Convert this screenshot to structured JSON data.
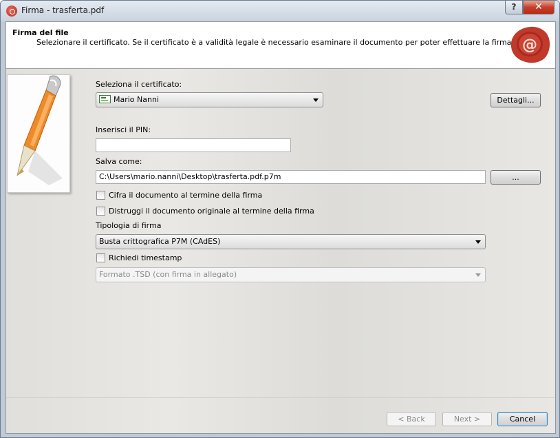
{
  "window": {
    "title": "Firma - trasferta.pdf",
    "help_label": "?",
    "close_label": "✕"
  },
  "header": {
    "title": "Firma del file",
    "subtitle": "Selezionare il certificato. Se il certificato è a validità legale è necessario esaminare il documento per poter effettuare la firma",
    "seal_text": "@"
  },
  "form": {
    "certificate_label": "Seleziona il certificato:",
    "certificate_value": "Mario Nanni",
    "details_button": "Dettagli...",
    "pin_label": "Inserisci il PIN:",
    "pin_value": "",
    "save_as_label": "Salva come:",
    "save_as_value": "C:\\Users\\mario.nanni\\Desktop\\trasferta.pdf.p7m",
    "browse_button": "...",
    "encrypt_label": "Cifra il documento al termine della firma",
    "encrypt_checked": false,
    "destroy_label": "Distruggi il documento originale al termine della firma",
    "destroy_checked": false,
    "signature_type_label": "Tipologia di firma",
    "signature_type_value": "Busta crittografica P7M (CAdES)",
    "timestamp_label": "Richiedi timestamp",
    "timestamp_checked": false,
    "timestamp_format_value": "Formato .TSD (con firma in allegato)"
  },
  "footer": {
    "back_button": "< Back",
    "next_button": "Next >",
    "cancel_button": "Cancel"
  },
  "colors": {
    "close_button": "#c7402b",
    "seal": "#c0392b",
    "pen_body": "#f08a24"
  },
  "icons": {
    "app": "wax-seal-icon",
    "seal": "wax-seal-at-icon",
    "side": "pen-icon",
    "certificate": "certificate-icon"
  }
}
